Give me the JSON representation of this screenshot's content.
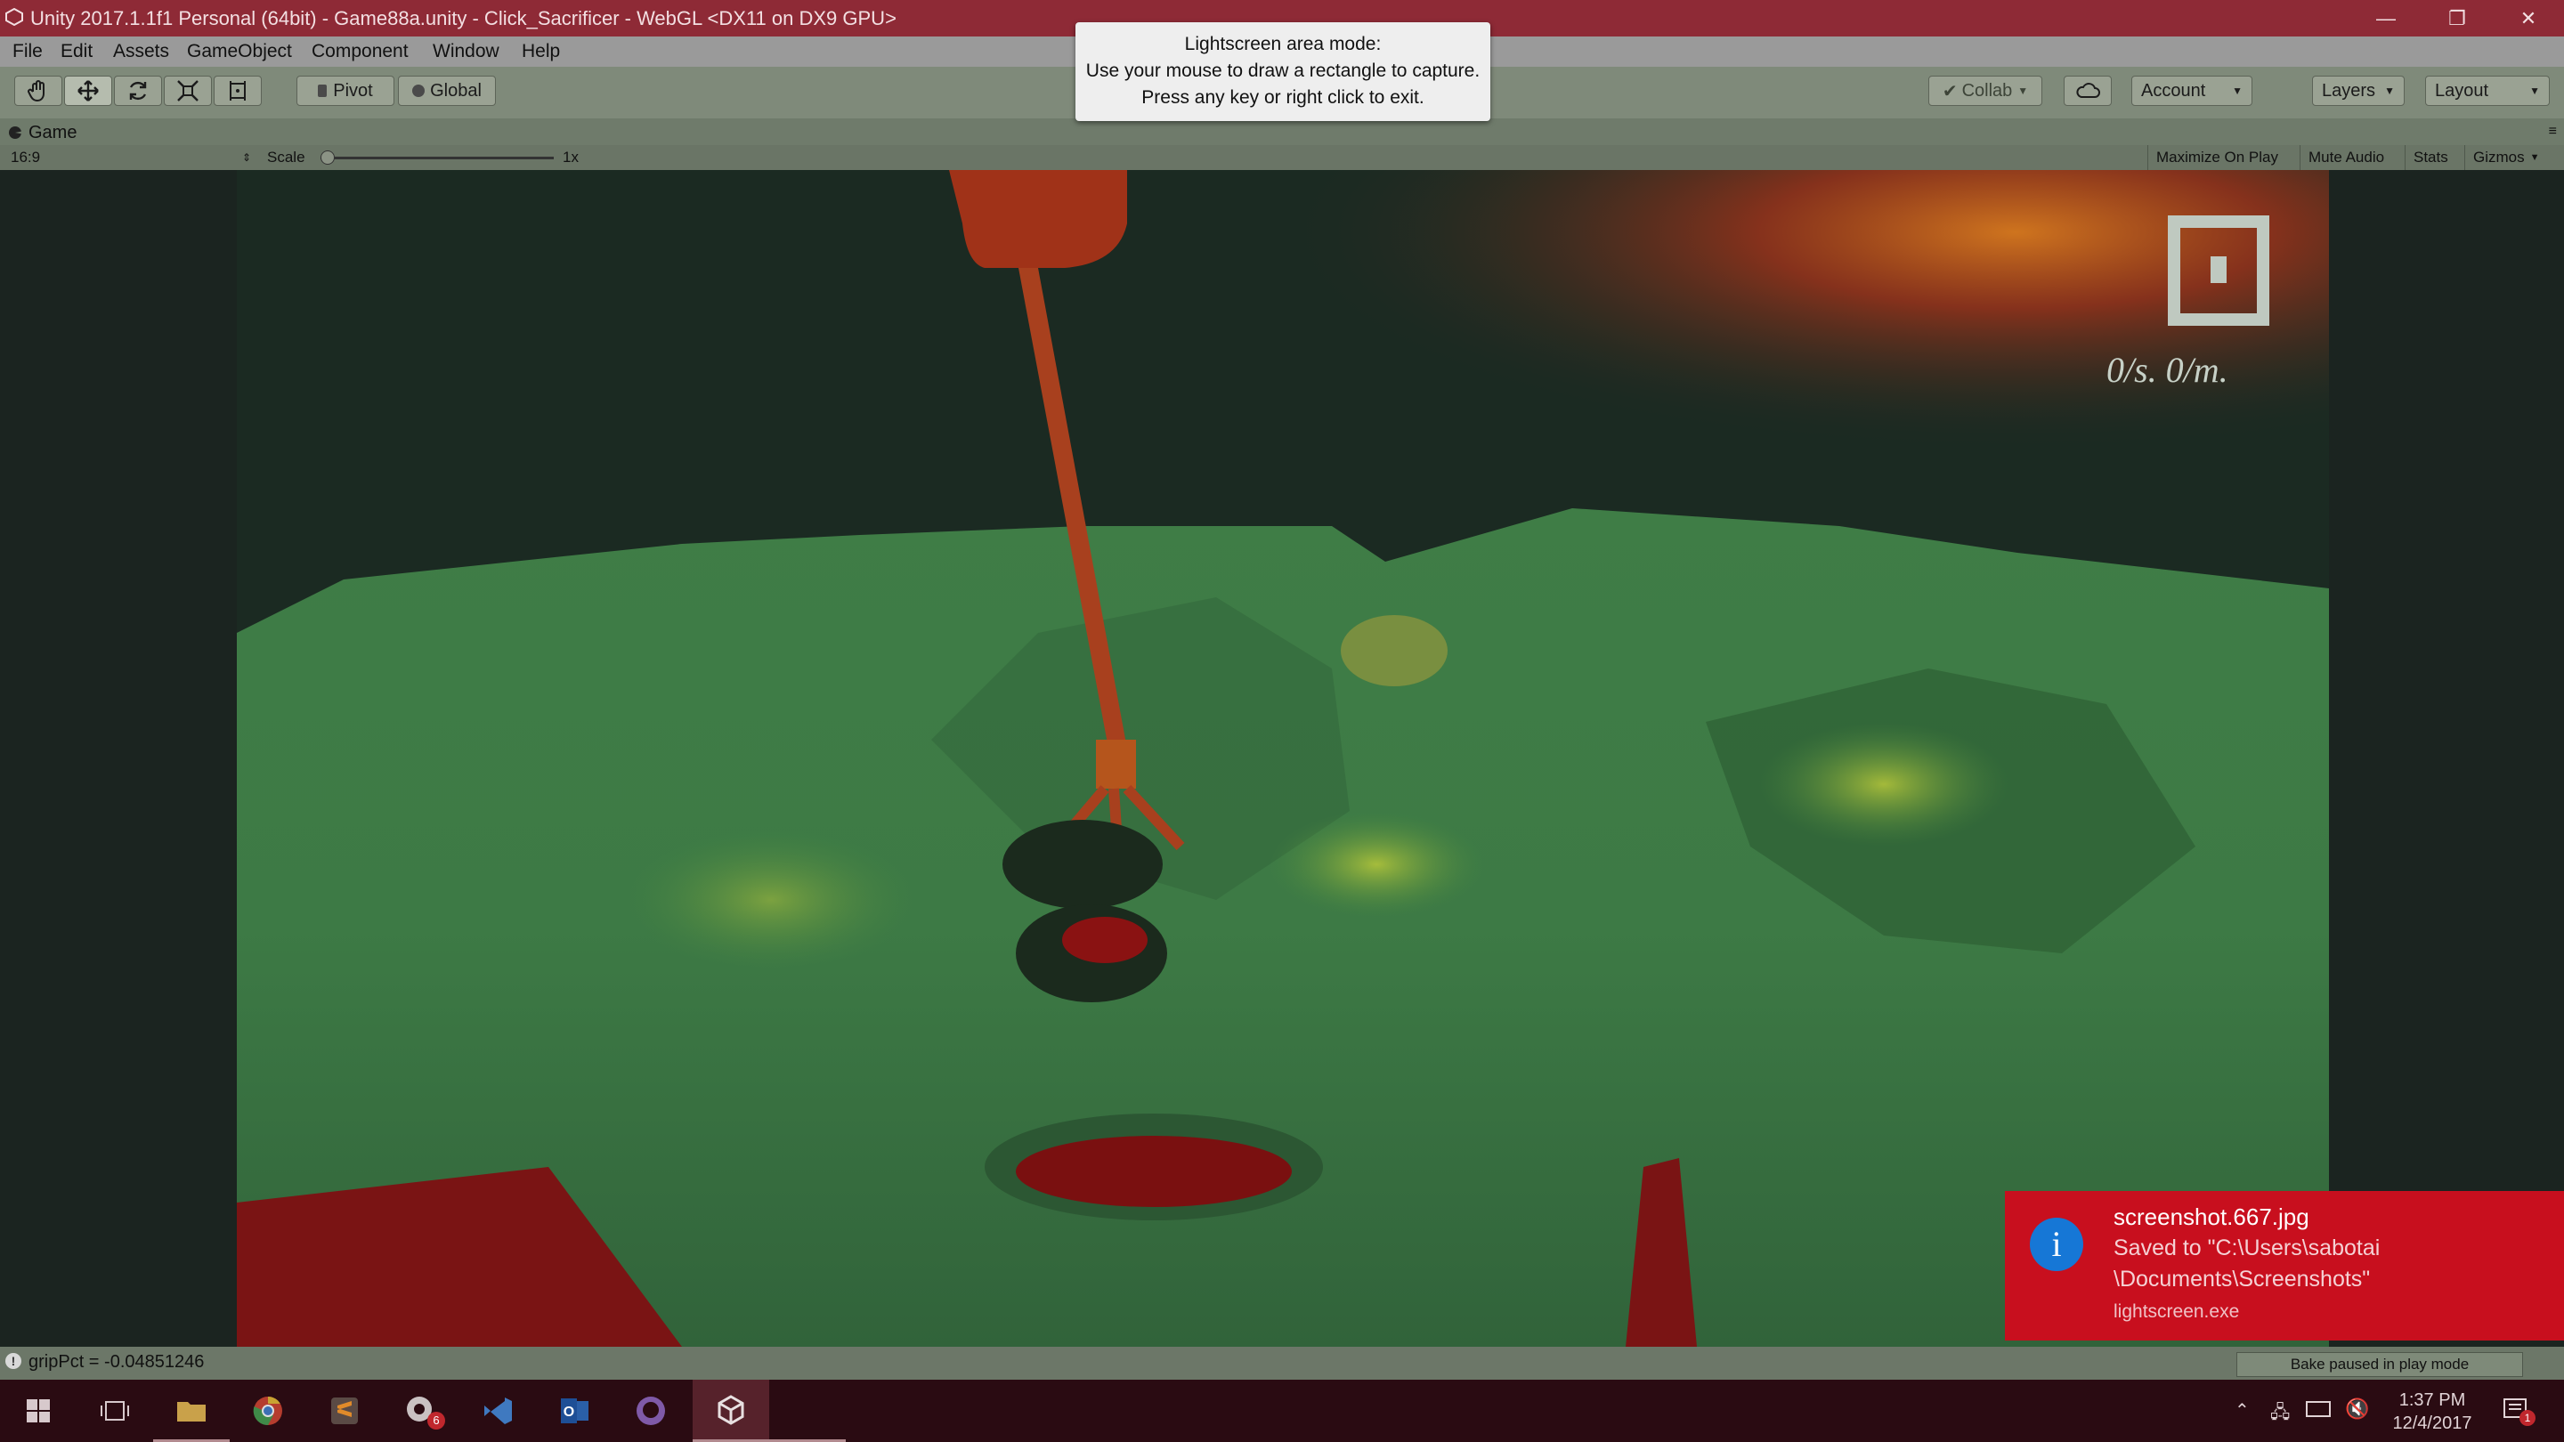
{
  "window": {
    "title": "Unity 2017.1.1f1 Personal (64bit) - Game88a.unity - Click_Sacrificer - WebGL <DX11 on DX9 GPU>",
    "minimize": "—",
    "restore": "❐",
    "close": "✕"
  },
  "menu": [
    "File",
    "Edit",
    "Assets",
    "GameObject",
    "Component",
    "Window",
    "Help"
  ],
  "toolbar": {
    "pivot": "Pivot",
    "global": "Global",
    "collab": "Collab",
    "account": "Account",
    "layers": "Layers",
    "layout": "Layout"
  },
  "game": {
    "tab_label": "Game",
    "aspect": "16:9",
    "scale_label": "Scale",
    "scale_value": "1x",
    "scale_level": 0.0,
    "maximize_on_play": "Maximize On Play",
    "mute_audio": "Mute Audio",
    "stats": "Stats",
    "gizmos": "Gizmos",
    "hud_counter": "0/s.  0/m."
  },
  "popup": {
    "line1": "Lightscreen area mode:",
    "line2": "Use your mouse to draw a rectangle to capture.",
    "line3": "Press any key or right click to exit."
  },
  "status": {
    "log": "gripPct = -0.04851246",
    "bake": "Bake paused in play mode"
  },
  "toast": {
    "title": "screenshot.667.jpg",
    "line1": "Saved to \"C:\\Users\\sabotai",
    "line2": "\\Documents\\Screenshots\"",
    "app": "lightscreen.exe",
    "info_glyph": "i"
  },
  "taskbar": {
    "time": "1:37 PM",
    "date": "12/4/2017",
    "badge": "6",
    "notif": "1"
  },
  "colors": {
    "titlebar": "#8e2a36",
    "toast": "#c80f1e",
    "taskbar": "#2a0b12"
  }
}
